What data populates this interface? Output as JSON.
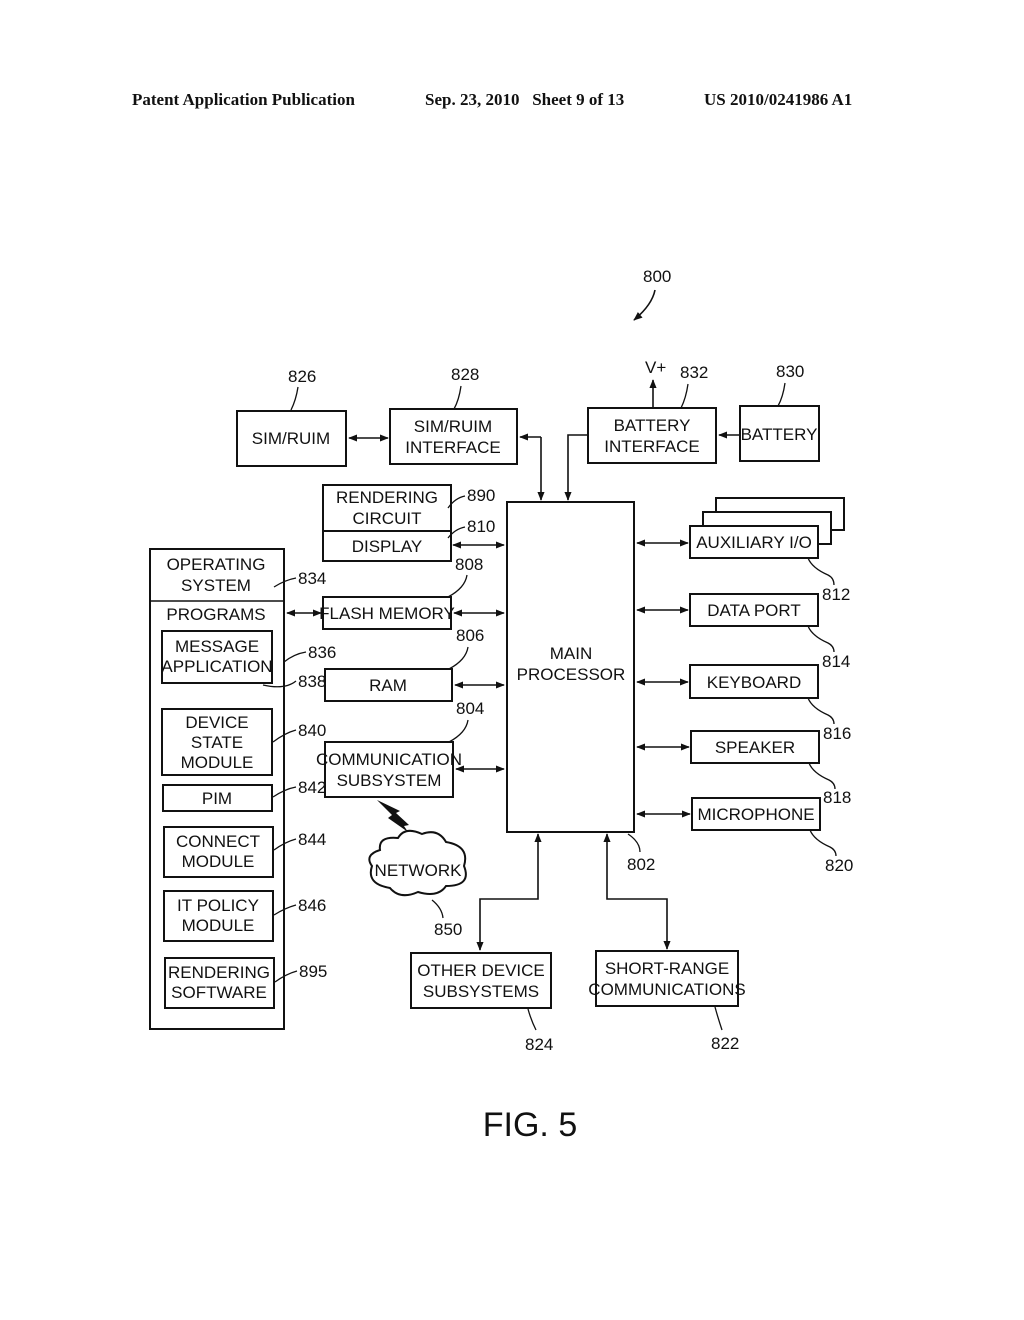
{
  "header": {
    "publication": "Patent Application Publication",
    "date_sheet": "Sep. 23, 2010   Sheet 9 of 13",
    "number": "US 2010/0241986 A1"
  },
  "figure": {
    "caption": "FIG. 5",
    "ref": "800",
    "vplus": "V+"
  },
  "blocks": {
    "sim": {
      "l1": "SIM/RUIM",
      "ref": "826"
    },
    "sim_if": {
      "l1": "SIM/RUIM",
      "l2": "INTERFACE",
      "ref": "828"
    },
    "bat_if": {
      "l1": "BATTERY",
      "l2": "INTERFACE",
      "ref": "832"
    },
    "battery": {
      "l1": "BATTERY",
      "ref": "830"
    },
    "render_circuit": {
      "l1": "RENDERING",
      "l2": "CIRCUIT",
      "ref": "890"
    },
    "display": {
      "l1": "DISPLAY",
      "ref": "810"
    },
    "os": {
      "l1": "OPERATING",
      "l2": "SYSTEM",
      "ref": "834"
    },
    "programs": {
      "l1": "PROGRAMS",
      "ref": "836"
    },
    "msg_app": {
      "l1": "MESSAGE",
      "l2": "APPLICATION",
      "ref": "838"
    },
    "device_state": {
      "l1": "DEVICE",
      "l2": "STATE",
      "l3": "MODULE",
      "ref": "840"
    },
    "pim": {
      "l1": "PIM",
      "ref": "842"
    },
    "connect": {
      "l1": "CONNECT",
      "l2": "MODULE",
      "ref": "844"
    },
    "it_policy": {
      "l1": "IT POLICY",
      "l2": "MODULE",
      "ref": "846"
    },
    "render_sw": {
      "l1": "RENDERING",
      "l2": "SOFTWARE",
      "ref": "895"
    },
    "flash": {
      "l1": "FLASH MEMORY",
      "ref": "808"
    },
    "ram": {
      "l1": "RAM",
      "ref": "806"
    },
    "comm": {
      "l1": "COMMUNICATION",
      "l2": "SUBSYSTEM",
      "ref": "804"
    },
    "network": {
      "l1": "NETWORK",
      "ref": "850"
    },
    "main": {
      "l1": "MAIN",
      "l2": "PROCESSOR",
      "ref": "802"
    },
    "aux": {
      "l1": "AUXILIARY I/O",
      "ref": "812"
    },
    "dataport": {
      "l1": "DATA PORT",
      "ref": "814"
    },
    "keyboard": {
      "l1": "KEYBOARD",
      "ref": "816"
    },
    "speaker": {
      "l1": "SPEAKER",
      "ref": "818"
    },
    "mic": {
      "l1": "MICROPHONE",
      "ref": "820"
    },
    "other": {
      "l1": "OTHER DEVICE",
      "l2": "SUBSYSTEMS",
      "ref": "824"
    },
    "short": {
      "l1": "SHORT-RANGE",
      "l2": "COMMUNICATIONS",
      "ref": "822"
    }
  }
}
